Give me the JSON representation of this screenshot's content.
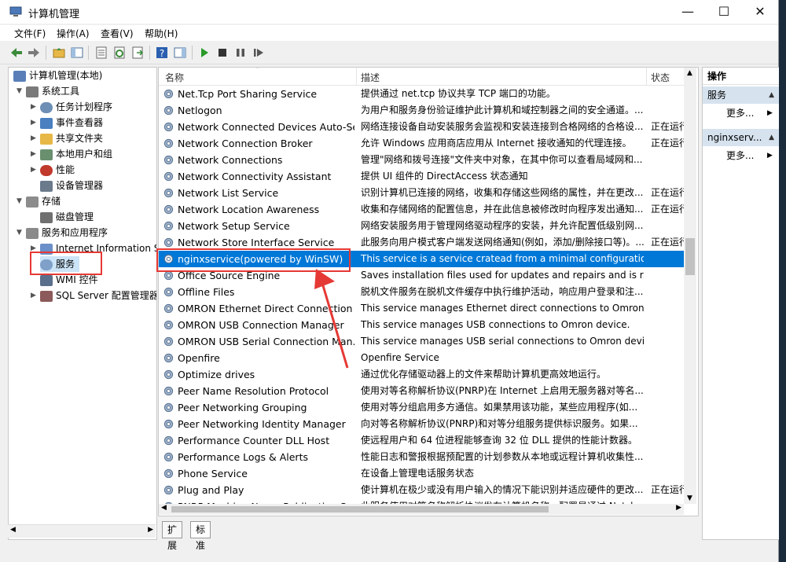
{
  "window": {
    "title": "计算机管理"
  },
  "menu": [
    "文件(F)",
    "操作(A)",
    "查看(V)",
    "帮助(H)"
  ],
  "tree": [
    {
      "label": "计算机管理(本地)",
      "level": 0,
      "expanded": true,
      "icon": "computer-mgmt-icon",
      "color": "#5a7fb8"
    },
    {
      "label": "系统工具",
      "level": 1,
      "expanded": true,
      "icon": "tools-icon",
      "color": "#7a7a7a"
    },
    {
      "label": "任务计划程序",
      "level": 2,
      "expanded": false,
      "icon": "clock-icon",
      "color": "#6d8fb5"
    },
    {
      "label": "事件查看器",
      "level": 2,
      "expanded": false,
      "icon": "event-viewer-icon",
      "color": "#4a7fc0"
    },
    {
      "label": "共享文件夹",
      "level": 2,
      "expanded": false,
      "icon": "shared-folder-icon",
      "color": "#e7b847"
    },
    {
      "label": "本地用户和组",
      "level": 2,
      "expanded": false,
      "icon": "users-icon",
      "color": "#6a8f6f"
    },
    {
      "label": "性能",
      "level": 2,
      "expanded": false,
      "icon": "performance-icon",
      "color": "#c0392b"
    },
    {
      "label": "设备管理器",
      "level": 2,
      "expanded": null,
      "icon": "device-manager-icon",
      "color": "#6b7b8c"
    },
    {
      "label": "存储",
      "level": 1,
      "expanded": true,
      "icon": "storage-icon",
      "color": "#8c8c8c"
    },
    {
      "label": "磁盘管理",
      "level": 2,
      "expanded": null,
      "icon": "disk-icon",
      "color": "#707070"
    },
    {
      "label": "服务和应用程序",
      "level": 1,
      "expanded": true,
      "icon": "services-apps-icon",
      "color": "#8a8a8a"
    },
    {
      "label": "Internet Information S",
      "level": 2,
      "expanded": false,
      "icon": "iis-icon",
      "color": "#6b8fc8"
    },
    {
      "label": "服务",
      "level": 2,
      "expanded": null,
      "icon": "services-icon",
      "color": "#7fa0c8"
    },
    {
      "label": "WMI 控件",
      "level": 2,
      "expanded": null,
      "icon": "wmi-icon",
      "color": "#5a6f8c"
    },
    {
      "label": "SQL Server 配置管理器",
      "level": 2,
      "expanded": false,
      "icon": "sql-server-icon",
      "color": "#8c5a5a"
    }
  ],
  "columns": {
    "name": "名称",
    "desc": "描述",
    "status": "状态"
  },
  "services": [
    {
      "name": "Net.Tcp Port Sharing Service",
      "desc": "提供通过 net.tcp 协议共享 TCP 端口的功能。",
      "status": ""
    },
    {
      "name": "Netlogon",
      "desc": "为用户和服务身份验证维护此计算机和域控制器之间的安全通道。...",
      "status": ""
    },
    {
      "name": "Network Connected Devices Auto-Se...",
      "desc": "网络连接设备自动安装服务会监视和安装连接到合格网络的合格设...",
      "status": "正在运行"
    },
    {
      "name": "Network Connection Broker",
      "desc": "允许 Windows 应用商店应用从 Internet 接收通知的代理连接。",
      "status": "正在运行"
    },
    {
      "name": "Network Connections",
      "desc": "管理\"网络和拨号连接\"文件夹中对象，在其中你可以查看局域网和...",
      "status": ""
    },
    {
      "name": "Network Connectivity Assistant",
      "desc": "提供 UI 组件的 DirectAccess 状态通知",
      "status": ""
    },
    {
      "name": "Network List Service",
      "desc": "识别计算机已连接的网络，收集和存储这些网络的属性，并在更改...",
      "status": "正在运行"
    },
    {
      "name": "Network Location Awareness",
      "desc": "收集和存储网络的配置信息，并在此信息被修改时向程序发出通知...",
      "status": "正在运行"
    },
    {
      "name": "Network Setup Service",
      "desc": "网络安装服务用于管理网络驱动程序的安装，并允许配置低级别网...",
      "status": ""
    },
    {
      "name": "Network Store Interface Service",
      "desc": "此服务向用户模式客户端发送网络通知(例如，添加/删除接口等)。...",
      "status": "正在运行"
    },
    {
      "name": "nginxservice(powered by WinSW)",
      "desc": "This service is a service cratead from a minimal configuration",
      "status": "",
      "selected": true
    },
    {
      "name": "Office  Source Engine",
      "desc": "Saves installation files used for updates and repairs and is r...",
      "status": ""
    },
    {
      "name": "Offline Files",
      "desc": "脱机文件服务在脱机文件缓存中执行维护活动，响应用户登录和注...",
      "status": ""
    },
    {
      "name": "OMRON Ethernet Direct Connection ...",
      "desc": "This service manages Ethernet direct connections to Omron...",
      "status": ""
    },
    {
      "name": "OMRON USB Connection Manager",
      "desc": "This service manages USB connections to Omron device.",
      "status": ""
    },
    {
      "name": "OMRON USB Serial Connection Man...",
      "desc": "This service manages USB serial connections to Omron devi...",
      "status": ""
    },
    {
      "name": "Openfire",
      "desc": "Openfire Service",
      "status": ""
    },
    {
      "name": "Optimize drives",
      "desc": "通过优化存储驱动器上的文件来帮助计算机更高效地运行。",
      "status": ""
    },
    {
      "name": "Peer Name Resolution Protocol",
      "desc": "使用对等名称解析协议(PNRP)在 Internet 上启用无服务器对等名...",
      "status": ""
    },
    {
      "name": "Peer Networking Grouping",
      "desc": "使用对等分组启用多方通信。如果禁用该功能，某些应用程序(如...",
      "status": ""
    },
    {
      "name": "Peer Networking Identity Manager",
      "desc": "向对等名称解析协议(PNRP)和对等分组服务提供标识服务。如果...",
      "status": ""
    },
    {
      "name": "Performance Counter DLL Host",
      "desc": "使远程用户和 64 位进程能够查询 32 位 DLL 提供的性能计数器。",
      "status": ""
    },
    {
      "name": "Performance Logs & Alerts",
      "desc": "性能日志和警报根据预配置的计划参数从本地或远程计算机收集性...",
      "status": ""
    },
    {
      "name": "Phone Service",
      "desc": "在设备上管理电话服务状态",
      "status": ""
    },
    {
      "name": "Plug and Play",
      "desc": "使计算机在极少或没有用户输入的情况下能识别并适应硬件的更改...",
      "status": "正在运行"
    },
    {
      "name": "PNRP Machine Name Publication Ser...",
      "desc": "此服务使用对等名称解析协议发布计算机名称。配置是通过 Netsh...",
      "status": ""
    }
  ],
  "tabs": [
    "扩展",
    "标准"
  ],
  "actions": {
    "header": "操作",
    "sections": [
      {
        "title": "服务",
        "item": "更多..."
      },
      {
        "title": "nginxserv...",
        "item": "更多..."
      }
    ]
  },
  "colors": {
    "selection": "#0078d7",
    "annotation": "#e53935",
    "action_section": "#d6e3ef"
  }
}
